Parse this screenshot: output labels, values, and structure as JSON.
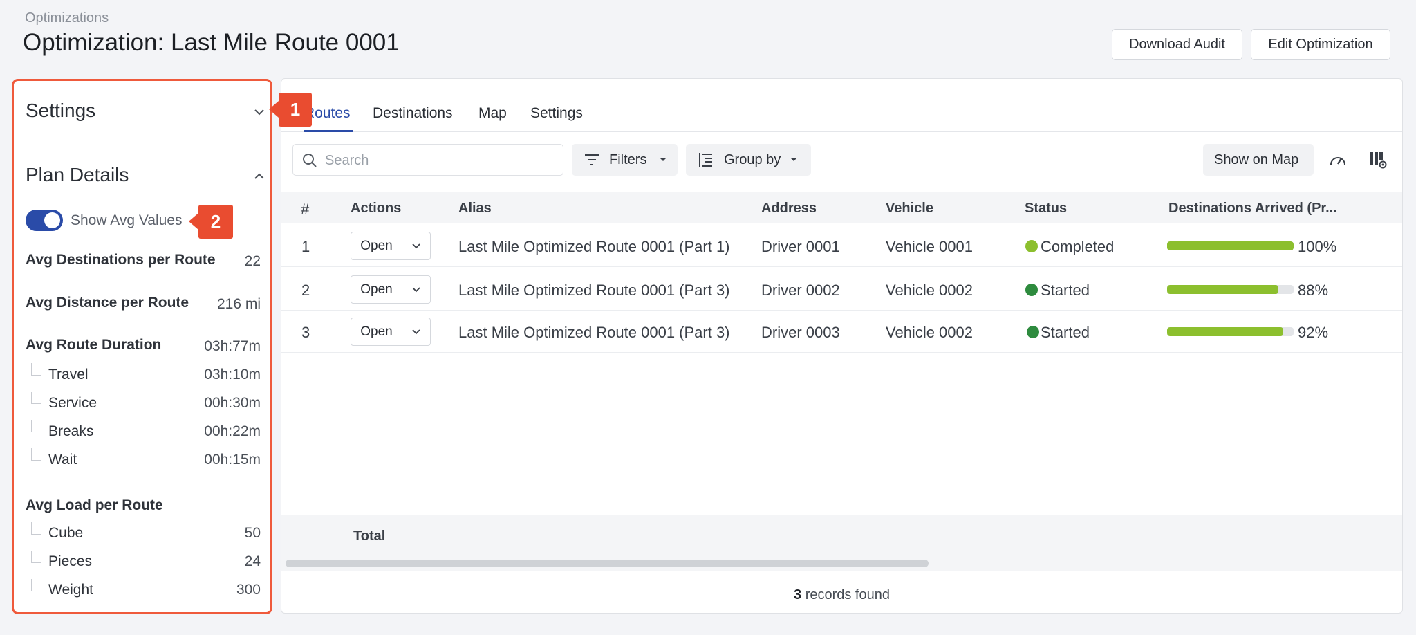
{
  "header": {
    "breadcrumb": "Optimizations",
    "title": "Optimization: Last Mile Route 0001",
    "download_audit": "Download Audit",
    "edit_optimization": "Edit Optimization"
  },
  "left_panel": {
    "settings_title": "Settings",
    "plan_details_title": "Plan Details",
    "toggle_label": "Show Avg Values",
    "toggle_on": true,
    "stats": {
      "avg_destinations_label": "Avg Destinations per Route",
      "avg_destinations_value": "22",
      "avg_distance_label": "Avg Distance per Route",
      "avg_distance_value": "216 mi",
      "avg_duration_label": "Avg Route Duration",
      "avg_duration_value": "03h:77m",
      "duration_items": [
        {
          "label": "Travel",
          "value": "03h:10m"
        },
        {
          "label": "Service",
          "value": "00h:30m"
        },
        {
          "label": "Breaks",
          "value": "00h:22m"
        },
        {
          "label": "Wait",
          "value": "00h:15m"
        }
      ],
      "avg_load_label": "Avg Load per Route",
      "load_items": [
        {
          "label": "Cube",
          "value": "50"
        },
        {
          "label": "Pieces",
          "value": "24"
        },
        {
          "label": "Weight",
          "value": "300"
        }
      ]
    }
  },
  "callouts": {
    "one": "1",
    "two": "2"
  },
  "tabs": [
    "Routes",
    "Destinations",
    "Map",
    "Settings"
  ],
  "toolbar": {
    "search_placeholder": "Search",
    "filters": "Filters",
    "group_by": "Group by",
    "show_on_map": "Show on Map"
  },
  "grid": {
    "headers": {
      "num": "#",
      "actions": "Actions",
      "alias": "Alias",
      "address": "Address",
      "vehicle": "Vehicle",
      "status": "Status",
      "arrived": "Destinations Arrived (Pr..."
    },
    "open_label": "Open",
    "rows": [
      {
        "num": "1",
        "alias": "Last Mile Optimized Route 0001 (Part 1)",
        "address": "Driver 0001",
        "vehicle": "Vehicle 0001",
        "status": "Completed",
        "status_color": "#8cbf2e",
        "progress": 1.0,
        "pct": "100%"
      },
      {
        "num": "2",
        "alias": "Last Mile Optimized Route 0001 (Part 3)",
        "address": "Driver 0002",
        "vehicle": "Vehicle 0002",
        "status": "Started",
        "status_color": "#2e8b3e",
        "progress": 0.88,
        "pct": "88%"
      },
      {
        "num": "3",
        "alias": "Last Mile Optimized Route 0001 (Part 3)",
        "address": "Driver 0003",
        "vehicle": "Vehicle 0002",
        "status": "Started",
        "status_color": "#2e8b3e",
        "progress": 0.92,
        "pct": "92%"
      }
    ],
    "total_label": "Total",
    "records_count": "3",
    "records_text": "records found"
  },
  "colors": {
    "accent": "#2a4ba8",
    "callout": "#e94c30",
    "progress": "#8cbf2e"
  }
}
